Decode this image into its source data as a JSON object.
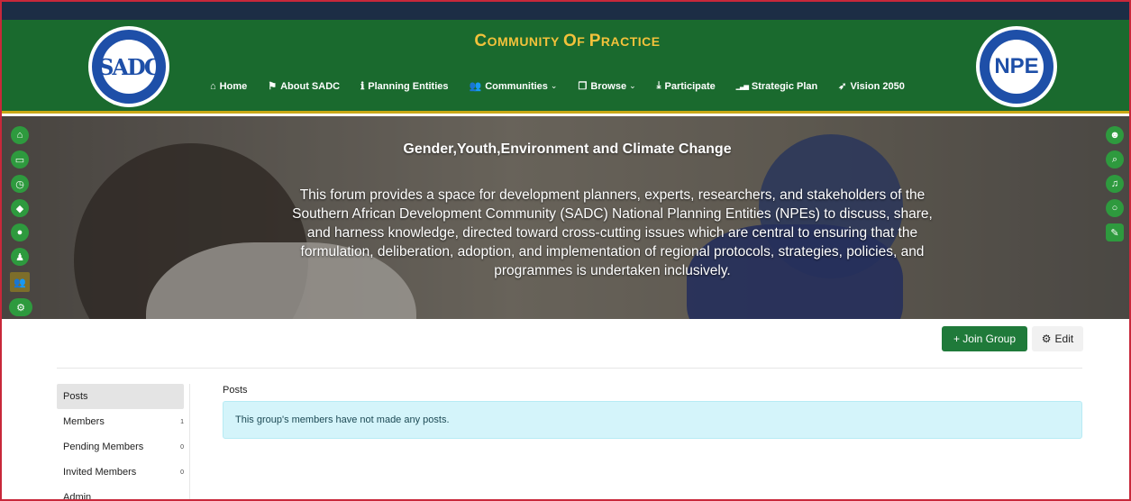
{
  "header": {
    "title_parts": [
      {
        "cap": "C",
        "rest": "OMMUNITY"
      },
      {
        "cap": "O",
        "rest": "F"
      },
      {
        "cap": "P",
        "rest": "RACTICE"
      }
    ],
    "logo_left_text": "SADC",
    "logo_right_text": "NPE",
    "nav": [
      {
        "label": "Home",
        "icon": "home-icon",
        "glyph": "⌂"
      },
      {
        "label": "About SADC",
        "icon": "flag-icon",
        "glyph": "⚑"
      },
      {
        "label": "Planning Entities",
        "icon": "info-icon",
        "glyph": "ℹ"
      },
      {
        "label": "Communities",
        "icon": "users-icon",
        "glyph": "👥",
        "chevron": "⌄"
      },
      {
        "label": "Browse",
        "icon": "window-icon",
        "glyph": "❐",
        "chevron": "⌄"
      },
      {
        "label": "Participate",
        "icon": "download-icon",
        "glyph": "⤓"
      },
      {
        "label": "Strategic Plan",
        "icon": "signal-icon",
        "glyph": "▁▃▅"
      },
      {
        "label": "Vision 2050",
        "icon": "rocket-icon",
        "glyph": "➶"
      }
    ]
  },
  "hero": {
    "title": "Gender,Youth,Environment and Climate Change",
    "description": "This forum provides a space for development planners, experts, researchers, and stakeholders of the Southern African Development Community (SADC) National Planning Entities (NPEs) to discuss, share, and harness knowledge, directed toward cross-cutting issues which are central to ensuring that the formulation, deliberation, adoption, and implementation of regional protocols, strategies, policies, and programmes is undertaken inclusively."
  },
  "left_toolbar": [
    {
      "icon": "home-icon",
      "glyph": "⌂"
    },
    {
      "icon": "inbox-icon",
      "glyph": "▭"
    },
    {
      "icon": "clock-icon",
      "glyph": "◷"
    },
    {
      "icon": "tags-icon",
      "glyph": "◆"
    },
    {
      "icon": "fire-icon",
      "glyph": "●"
    },
    {
      "icon": "user-icon",
      "glyph": "♟"
    },
    {
      "icon": "group-icon",
      "glyph": "👥"
    },
    {
      "icon": "cogs-icon",
      "glyph": "⚙"
    }
  ],
  "right_toolbar": [
    {
      "icon": "avatar-icon",
      "glyph": "☻"
    },
    {
      "icon": "search-icon",
      "glyph": "⌕"
    },
    {
      "icon": "bell-icon",
      "glyph": "♫"
    },
    {
      "icon": "chat-icon",
      "glyph": "○"
    },
    {
      "icon": "compose-icon",
      "glyph": "✎"
    }
  ],
  "actions": {
    "join_label": "+ Join Group",
    "edit_label": "Edit",
    "edit_glyph": "⚙"
  },
  "sidebar": {
    "items": [
      {
        "label": "Posts",
        "count": ""
      },
      {
        "label": "Members",
        "count": "1"
      },
      {
        "label": "Pending Members",
        "count": "0"
      },
      {
        "label": "Invited Members",
        "count": "0"
      },
      {
        "label": "Admin",
        "count": ""
      }
    ]
  },
  "main": {
    "section_title": "Posts",
    "empty_notice": "This group's members have not made any posts."
  }
}
